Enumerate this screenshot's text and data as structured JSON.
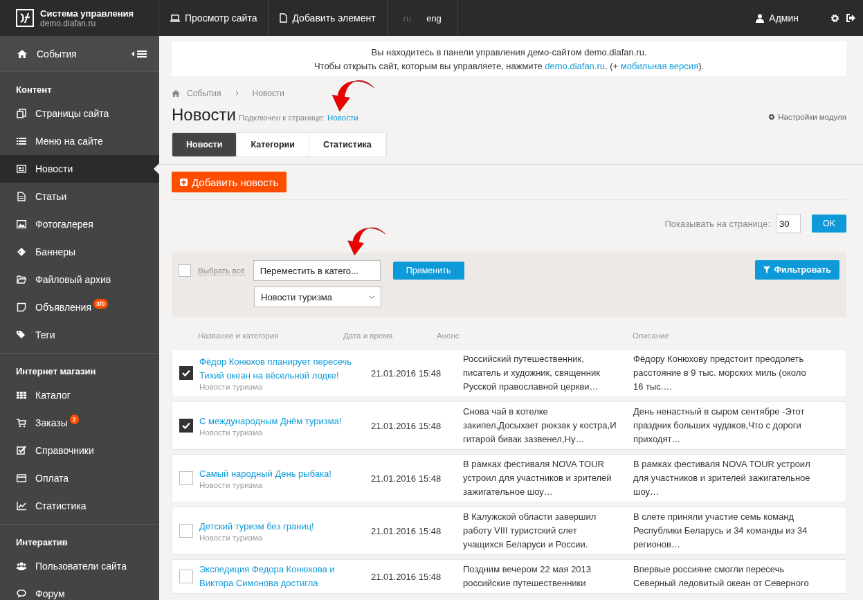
{
  "brand": {
    "title": "Система управления",
    "subtitle": "demo.diafan.ru"
  },
  "topbar": {
    "links": [
      {
        "label": "Просмотр сайта"
      },
      {
        "label": "Добавить элемент"
      }
    ],
    "languages": [
      {
        "label": "ru",
        "selected": false
      },
      {
        "label": "eng",
        "selected": true
      }
    ],
    "user": "Админ"
  },
  "sidebar": {
    "top_item": "События",
    "sections": [
      {
        "title": "Контент",
        "items": [
          {
            "label": "Страницы сайта",
            "selected": false
          },
          {
            "label": "Меню на сайте",
            "selected": false
          },
          {
            "label": "Новости",
            "selected": true
          },
          {
            "label": "Статьи",
            "selected": false
          },
          {
            "label": "Фотогалерея",
            "selected": false
          },
          {
            "label": "Баннеры",
            "selected": false
          },
          {
            "label": "Файловый архив",
            "selected": false
          },
          {
            "label": "Объявления",
            "selected": false,
            "badge": "3/0"
          },
          {
            "label": "Теги",
            "selected": false
          }
        ]
      },
      {
        "title": "Интернет магазин",
        "items": [
          {
            "label": "Каталог",
            "selected": false
          },
          {
            "label": "Заказы",
            "selected": false,
            "badge": "2"
          },
          {
            "label": "Справочники",
            "selected": false
          },
          {
            "label": "Оплата",
            "selected": false
          },
          {
            "label": "Статистика",
            "selected": false
          }
        ]
      },
      {
        "title": "Интерактив",
        "items": [
          {
            "label": "Пользователи сайта",
            "selected": false
          },
          {
            "label": "Форум",
            "selected": false
          }
        ]
      }
    ]
  },
  "notice": {
    "line_1": "Вы находитесь в панели управления демо-сайтом demo.diafan.ru.",
    "line_2_start": "Чтобы открыть сайт, которым вы управляете, нажмите ",
    "link": "demo.diafan.ru",
    "line_2_middle": ". (+ ",
    "mobile_link": "мобильная версия",
    "line_2_end": ")."
  },
  "breadcrumbs": [
    "События",
    "Новости"
  ],
  "page": {
    "title": "Новости",
    "connected_label": "Подключен к странице:",
    "connected_link": "Новости",
    "settings": "Настройки модуля"
  },
  "tabs": [
    {
      "label": "Новости",
      "selected": true
    },
    {
      "label": "Категории",
      "selected": false
    },
    {
      "label": "Статистика",
      "selected": false
    }
  ],
  "add_button": "Добавить новость",
  "per_page": {
    "label": "Показывать на странице:",
    "value": "30",
    "button": "OK"
  },
  "toolbar": {
    "select_all": {
      "label": "Выбрать всё",
      "checked": false
    },
    "action": "Переместить в катего...",
    "apply": "Применить",
    "category": "Новости туризма",
    "filter": "Фильтровать"
  },
  "table": {
    "columns": [
      "Название и категория",
      "Дата и время",
      "Анонс",
      "Описание"
    ],
    "rows": [
      {
        "checked": true,
        "title": "Фёдор Конюхов планирует пересечь Тихий океан на вёсельной лодке!",
        "category": "Новости туризма",
        "date": "21.01.2016 15:48",
        "anons": "Российский путешественник, писатель и художник, священник Русской православной церкви…",
        "description": "Фёдору Конюхову предстоит преодолеть расстояние в 9 тыс. морских миль (около 16 тыс.…"
      },
      {
        "checked": true,
        "title": "С международным Днём туризма!",
        "category": "Новости туризма",
        "date": "21.01.2016 15:48",
        "anons": "Снова чай в котелке закипел,Досыхает рюкзак у костра,И гитарой бивак зазвенел,Ну…",
        "description": "День ненастный в сыром сентябре -Этот праздник больших чудаков,Что с дороги приходят…"
      },
      {
        "checked": false,
        "title": "Самый народный День рыбака!",
        "category": "Новости туризма",
        "date": "21.01.2016 15:48",
        "anons": "В рамках фестиваля NOVA TOUR устроил для участников и зрителей зажигательное шоу…",
        "description": "В рамках фестиваля NOVA TOUR устроил для участников и зрителей зажигательное шоу…"
      },
      {
        "checked": false,
        "title": "Детский туризм без границ!",
        "category": "Новости туризма",
        "date": "21.01.2016 15:48",
        "anons": "В Калужской области завершил работу VIII туристский слет учащихся Беларуси и России.",
        "description": "В слете приняли участие семь команд Республики Беларусь и 34 команды из 34 регионов…"
      },
      {
        "checked": false,
        "title": "Экспедиция Федора Конюхова и Виктора Симонова достигла",
        "date": "21.01.2016 15:48",
        "anons": "Поздним вечером 22 мая 2013 российские путешественники",
        "description": "Впервые россияне смогли пересечь Северный ледовитый океан от Северного"
      }
    ]
  }
}
